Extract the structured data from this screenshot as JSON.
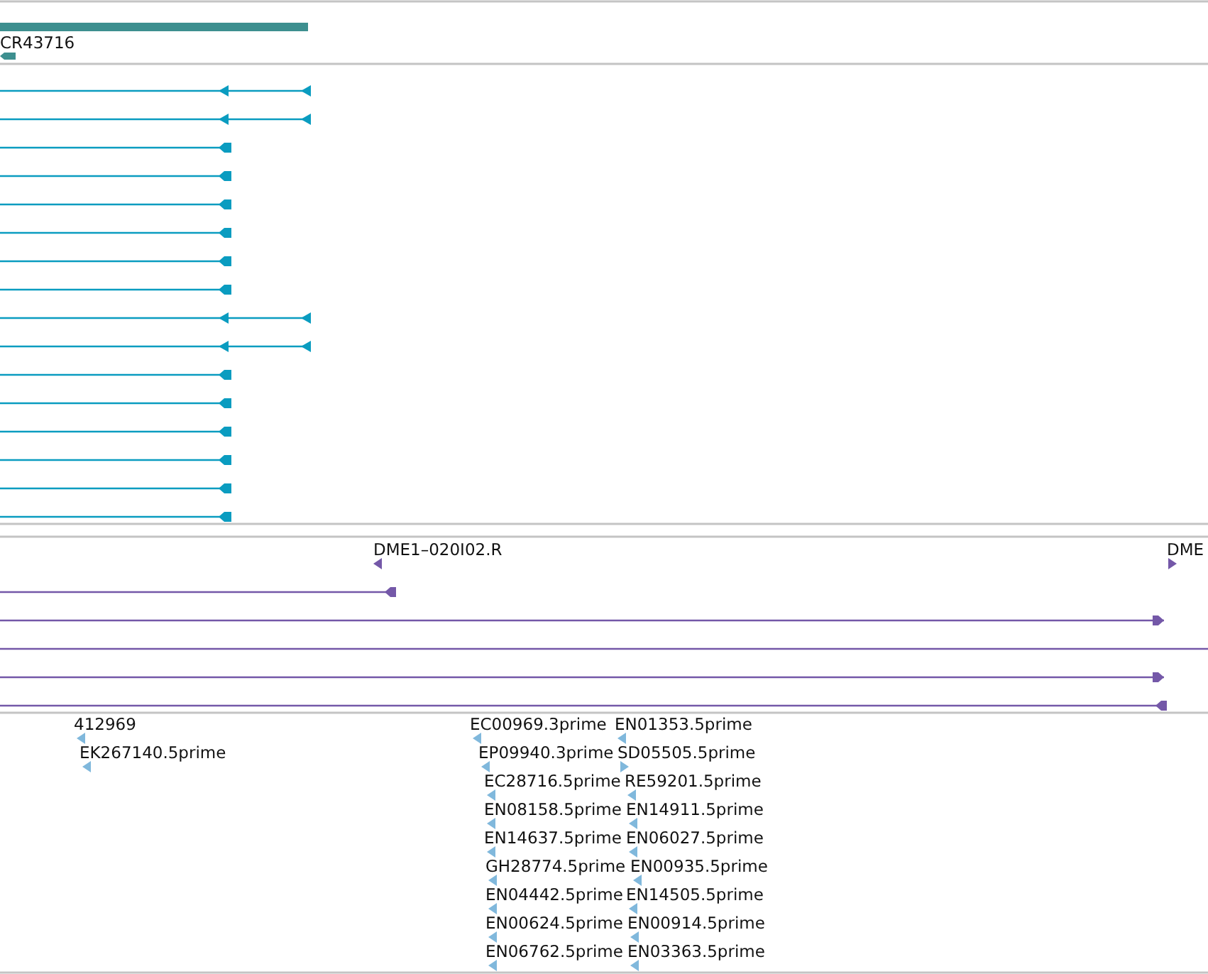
{
  "tracks": [
    {
      "kind": "gene",
      "label": "CR43716"
    },
    {
      "kind": "transcripts",
      "rows": [
        {
          "kind": "split"
        },
        {
          "kind": "split"
        },
        {
          "kind": "single"
        },
        {
          "kind": "single"
        },
        {
          "kind": "single"
        },
        {
          "kind": "single"
        },
        {
          "kind": "single"
        },
        {
          "kind": "single"
        },
        {
          "kind": "split"
        },
        {
          "kind": "split"
        },
        {
          "kind": "single"
        },
        {
          "kind": "single"
        },
        {
          "kind": "single"
        },
        {
          "kind": "single"
        },
        {
          "kind": "single"
        },
        {
          "kind": "single"
        }
      ]
    },
    {
      "kind": "clones",
      "labels": [
        {
          "text": "DME1–020I02.R",
          "kind": "left"
        },
        {
          "text": "DME",
          "kind": "right"
        }
      ],
      "rows": [
        {
          "kind": "left"
        },
        {
          "kind": "right"
        },
        {
          "kind": "plain"
        },
        {
          "kind": "right"
        },
        {
          "kind": "left"
        }
      ]
    },
    {
      "kind": "ests",
      "items": [
        {
          "label": "412969",
          "kind": "left"
        },
        {
          "label": "EC00969.3prime",
          "kind": "left"
        },
        {
          "label": "EN01353.5prime",
          "kind": "left"
        },
        {
          "label": "EK267140.5prime",
          "kind": "left"
        },
        {
          "label": "EP09940.3prime",
          "kind": "left"
        },
        {
          "label": "SD05505.5prime",
          "kind": "right"
        },
        {
          "label": "EC28716.5prime",
          "kind": "left"
        },
        {
          "label": "RE59201.5prime",
          "kind": "left"
        },
        {
          "label": "EN08158.5prime",
          "kind": "left"
        },
        {
          "label": "EN14911.5prime",
          "kind": "left"
        },
        {
          "label": "EN14637.5prime",
          "kind": "left"
        },
        {
          "label": "EN06027.5prime",
          "kind": "left"
        },
        {
          "label": "GH28774.5prime",
          "kind": "left"
        },
        {
          "label": "EN00935.5prime",
          "kind": "left"
        },
        {
          "label": "EN04442.5prime",
          "kind": "left"
        },
        {
          "label": "EN14505.5prime",
          "kind": "left"
        },
        {
          "label": "EN00624.5prime",
          "kind": "left"
        },
        {
          "label": "EN00914.5prime",
          "kind": "left"
        },
        {
          "label": "EN06762.5prime",
          "kind": "left"
        },
        {
          "label": "EN03363.5prime",
          "kind": "left"
        }
      ]
    }
  ]
}
